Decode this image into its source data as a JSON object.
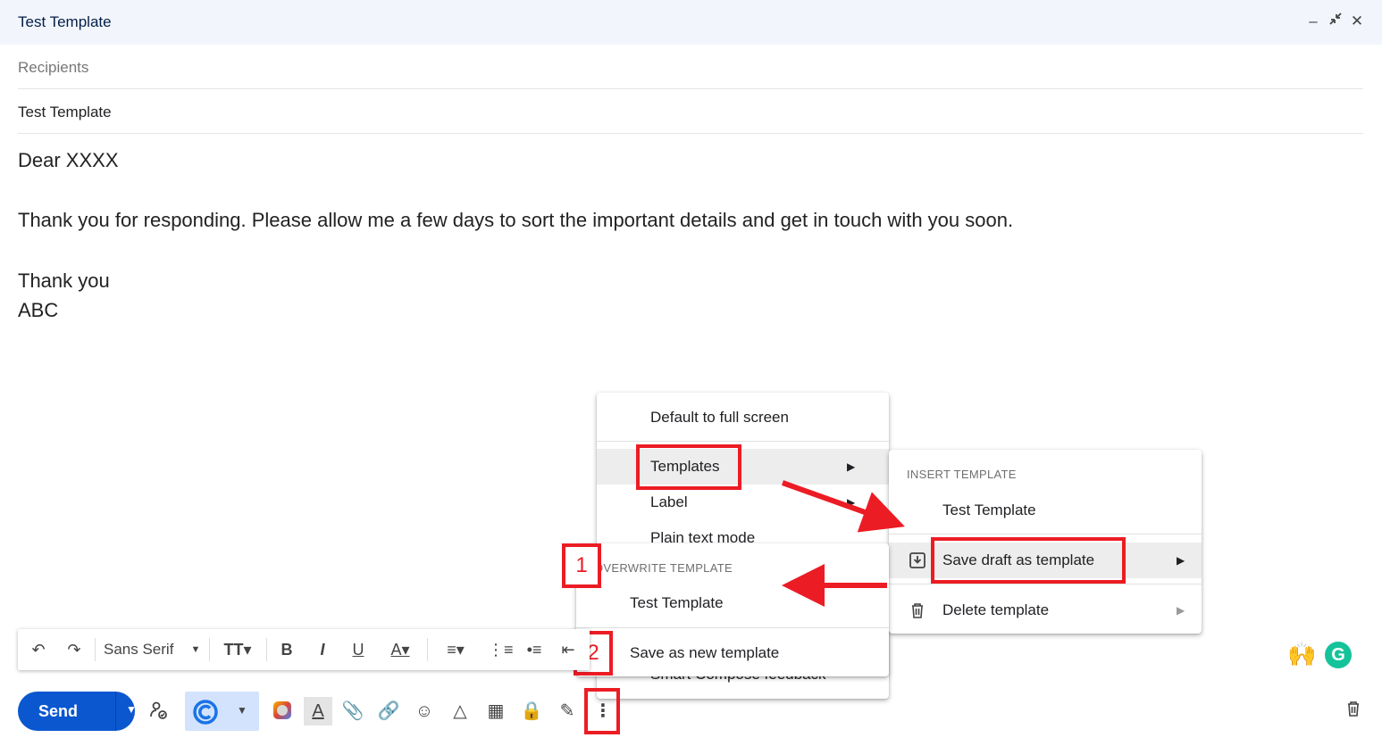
{
  "window": {
    "title": "Test Template"
  },
  "fields": {
    "recipients_placeholder": "Recipients",
    "subject": "Test Template"
  },
  "body": {
    "greeting": "Dear XXXX",
    "paragraph": "Thank you for responding. Please allow me a few days to sort the important details and get in touch with you soon.",
    "closing": "Thank you",
    "signature": "ABC"
  },
  "more_options_menu": {
    "items": [
      {
        "label": "Default to full screen"
      },
      {
        "label": "Templates"
      },
      {
        "label": "Label"
      },
      {
        "label": "Plain text mode"
      },
      {
        "label": "Smart Compose feedback"
      }
    ]
  },
  "templates_submenu": {
    "header": "INSERT TEMPLATE",
    "insert_item": "Test Template",
    "save_draft": "Save draft as template",
    "delete": "Delete template"
  },
  "save_draft_submenu": {
    "header": "OVERWRITE TEMPLATE",
    "overwrite_item": "Test Template",
    "save_new": "Save as new template"
  },
  "annotations": {
    "step1": "1",
    "step2": "2",
    "accent": "#ec1c24"
  },
  "format_toolbar": {
    "font": "Sans Serif"
  },
  "action_bar": {
    "send_label": "Send",
    "primary_color": "#0b57d0"
  },
  "icons": [
    "undo-icon",
    "redo-icon",
    "text-size-icon",
    "bold-icon",
    "italic-icon",
    "underline-icon",
    "text-color-icon",
    "align-icon",
    "numbered-list-icon",
    "bulleted-list-icon",
    "indent-icon",
    "schedule-send-icon",
    "copilot-icon",
    "color-palette-icon",
    "formatting-icon",
    "attach-icon",
    "link-icon",
    "emoji-icon",
    "drive-icon",
    "photo-icon",
    "confidential-icon",
    "signature-icon",
    "more-options-icon",
    "trash-icon",
    "celebrate-emoji",
    "grammarly-icon"
  ]
}
